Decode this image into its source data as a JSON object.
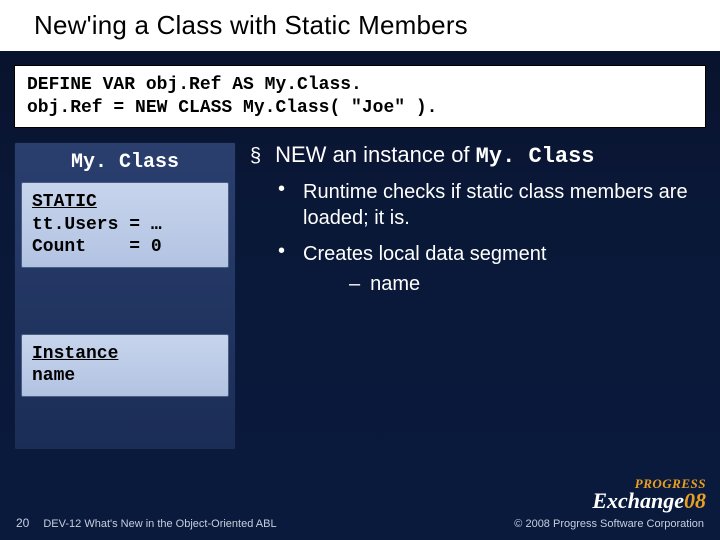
{
  "title": "New'ing a Class with Static Members",
  "code": {
    "line1": "DEFINE VAR obj.Ref AS My.Class.",
    "line2": "obj.Ref = NEW CLASS My.Class( \"Joe\" )."
  },
  "classbox": {
    "title": "My. Class",
    "static_label": "STATIC",
    "static_l1": "tt.Users = …",
    "static_l2": "Count    = 0",
    "instance_label": "Instance",
    "instance_l1": "name"
  },
  "bullets": {
    "sq": "§",
    "head_prefix": "NEW an instance of ",
    "head_mono": "My. Class",
    "dot": "•",
    "b1": "Runtime checks if static class members are loaded; it is.",
    "b2": "Creates local data segment",
    "dash": "–",
    "sub1": "name"
  },
  "footer": {
    "page": "20",
    "session": "DEV-12 What's New in the Object-Oriented ABL",
    "copyright": "© 2008 Progress Software Corporation"
  },
  "logo": {
    "top": "PROGRESS",
    "main_left": "Exchange",
    "main_right": "08"
  }
}
